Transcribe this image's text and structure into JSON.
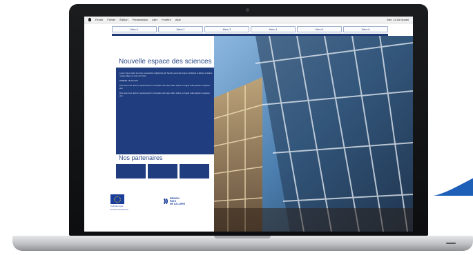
{
  "menubar": {
    "items": [
      "Finder",
      "Fichier",
      "Édition",
      "Présentation",
      "Aller",
      "Fenêtre",
      "Aide"
    ],
    "status": "Mer. 11:18  Mustel"
  },
  "site_nav": {
    "items": [
      "Menu 1",
      "Menu 2",
      "Menu 3",
      "Menu 4",
      "Menu 5",
      "Menu 6"
    ]
  },
  "page": {
    "title": "Nouvelle espace des sciences",
    "panel_paragraphs": [
      "Lorem ipsum dolor sit amet, consectetur adipiscing elit. Sed do eiusmod tempor incididunt ut labore et dolore magna aliqua ut enim ad minim.",
      "ROBERT 15-05-2015",
      "Duis aute irure dolor in reprehenderit in voluptate velit esse cillum dolore eu fugiat nulla pariatur excepteur sint.",
      "Duis aute irure dolor in reprehenderit in voluptate velit esse cillum dolore eu fugiat nulla pariatur excepteur sint."
    ],
    "partners_title": "Nos partenaires"
  },
  "logos": {
    "eu_text_line1": "Cofinancé par",
    "eu_text_line2": "l'Union européenne",
    "region_line1": "RÉGION",
    "region_line2": "PAYS",
    "region_line3": "DE LA LOIRE"
  },
  "colors": {
    "brand_blue": "#203e7f",
    "swoosh_blue": "#1e5fb8"
  }
}
